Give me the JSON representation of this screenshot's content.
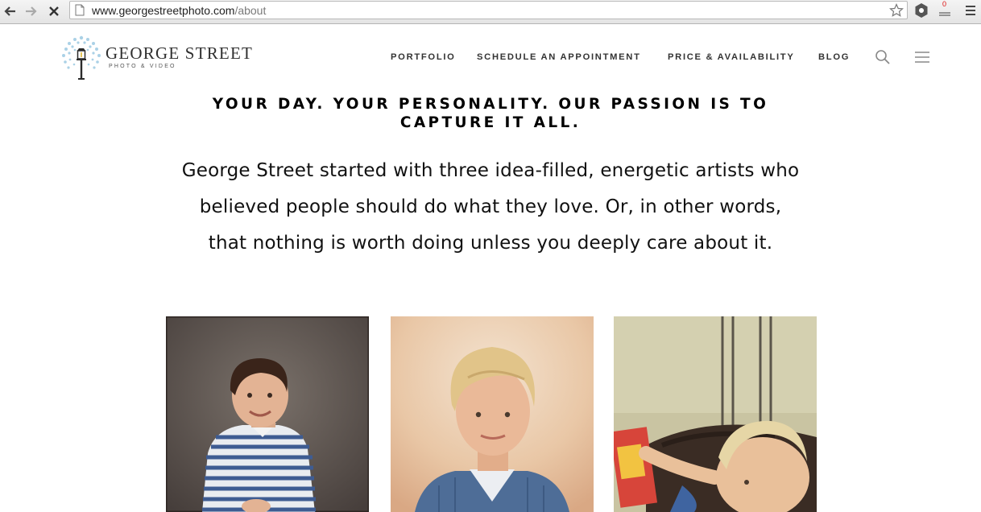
{
  "browser": {
    "url_host": "www.georgestreetphoto.com",
    "url_path": "/about",
    "extension_badge": "0"
  },
  "header": {
    "logo_title": "GEORGE STREET",
    "logo_subtitle": "PHOTO & VIDEO",
    "nav": [
      {
        "label": "PORTFOLIO"
      },
      {
        "label": "SCHEDULE AN APPOINTMENT"
      },
      {
        "label": "PRICE & AVAILABILITY"
      },
      {
        "label": "BLOG"
      }
    ]
  },
  "main": {
    "headline": "YOUR DAY. YOUR PERSONALITY. OUR PASSION IS TO CAPTURE IT ALL.",
    "intro_lines": [
      "George Street started with three idea-filled, energetic artists who",
      "believed people should do what they love. Or, in other words,",
      "that nothing is worth doing unless you deeply care about it."
    ]
  },
  "colors": {
    "chrome_bg": "#e8e8e8",
    "text": "#111111",
    "nav_text": "#333333",
    "logo_blue": "#7fb7d6"
  }
}
